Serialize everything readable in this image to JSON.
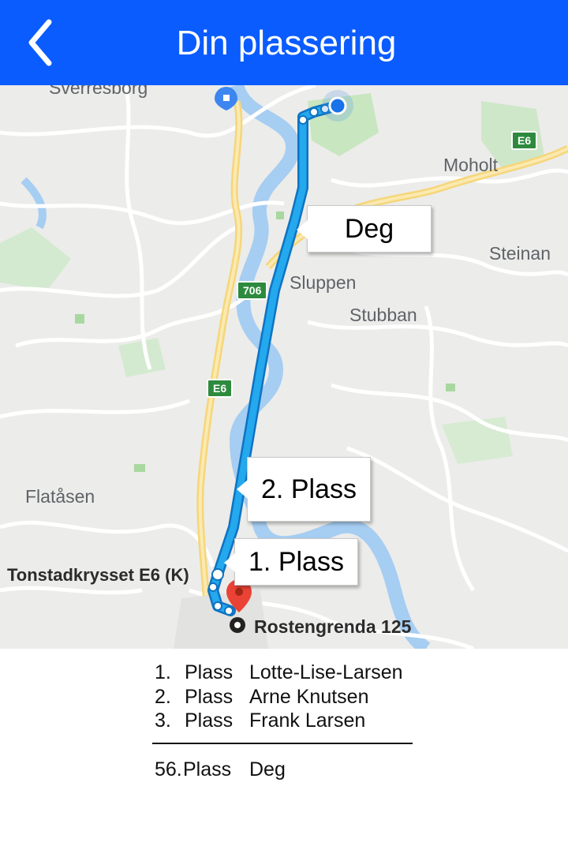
{
  "header": {
    "title": "Din plassering",
    "back_icon": "chevron-left-icon"
  },
  "colors": {
    "header_bg": "#0a5cff",
    "route": "#1a9be6",
    "pin": "#ea4335"
  },
  "map": {
    "places": {
      "sverresborg": "Sverresborg",
      "moholt": "Moholt",
      "steinan": "Steinan",
      "sluppen": "Sluppen",
      "stubban": "Stubban",
      "flataasen": "Flatåsen",
      "tonstad": "Tonstadkrysset E6 (K)",
      "destination": "Rostengrenda 125"
    },
    "roads": {
      "e6_top": "E6",
      "road_706": "706",
      "e6_mid": "E6"
    },
    "callouts": {
      "you": "Deg",
      "second": "2. Plass",
      "first": "1. Plass"
    }
  },
  "leaderboard": {
    "rows": [
      {
        "rank": "1.",
        "word": "Plass",
        "name": "Lotte-Lise-Larsen"
      },
      {
        "rank": "2.",
        "word": "Plass",
        "name": "Arne Knutsen"
      },
      {
        "rank": "3.",
        "word": "Plass",
        "name": "Frank Larsen"
      }
    ],
    "own": {
      "rank": "56.",
      "word": "Plass",
      "name": "Deg"
    }
  }
}
